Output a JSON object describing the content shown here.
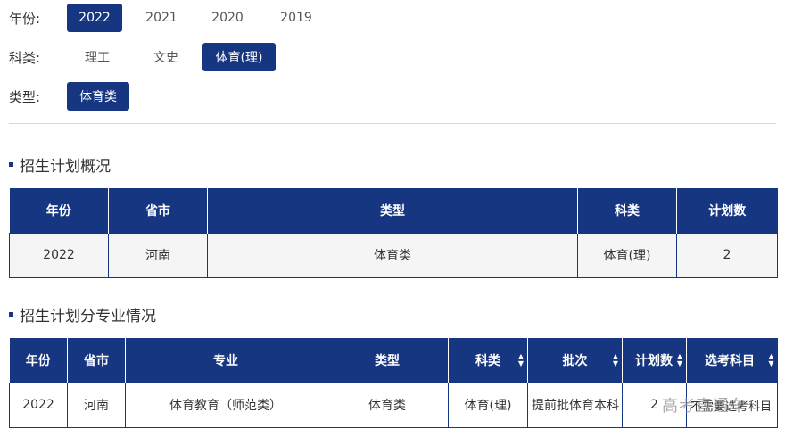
{
  "filters": {
    "year": {
      "label": "年份:",
      "options": [
        "2022",
        "2021",
        "2020",
        "2019"
      ],
      "selected": "2022"
    },
    "subject": {
      "label": "科类:",
      "options": [
        "理工",
        "文史",
        "体育(理)"
      ],
      "selected": "体育(理)"
    },
    "type": {
      "label": "类型:",
      "options": [
        "体育类"
      ],
      "selected": "体育类"
    }
  },
  "overview": {
    "title": "招生计划概况",
    "headers": [
      "年份",
      "省市",
      "类型",
      "科类",
      "计划数"
    ],
    "row": [
      "2022",
      "河南",
      "体育类",
      "体育(理)",
      "2"
    ]
  },
  "majors": {
    "title": "招生计划分专业情况",
    "headers": [
      "年份",
      "省市",
      "专业",
      "类型",
      "科类",
      "批次",
      "计划数",
      "选考科目"
    ],
    "row": [
      "2022",
      "河南",
      "体育教育（师范类）",
      "体育类",
      "体育(理)",
      "提前批体育本科",
      "2",
      "不需要选考科目"
    ]
  },
  "icons": {
    "sort": "sort-icon",
    "bullet": "square-bullet-icon"
  },
  "colors": {
    "accent": "#163681",
    "divider": "#d8d8d8"
  },
  "watermark": "高考直通车"
}
